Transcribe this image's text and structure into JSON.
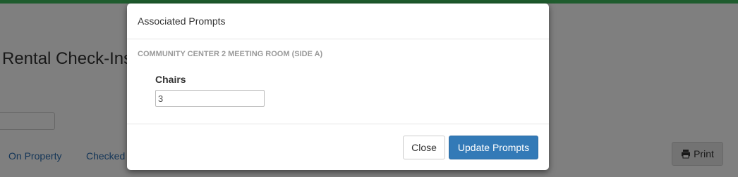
{
  "background_page": {
    "title": "Rental Check-Ins",
    "tabs": [
      {
        "label": "On Property"
      },
      {
        "label": "Checked Out"
      }
    ],
    "print_label": "Print",
    "print_icon": "print-icon",
    "accent_color": "#1f5c2e"
  },
  "modal": {
    "title": "Associated Prompts",
    "facility_name": "COMMUNITY CENTER 2 MEETING ROOM (SIDE A)",
    "prompts": [
      {
        "label": "Chairs",
        "value": "3"
      }
    ],
    "buttons": {
      "close_label": "Close",
      "update_label": "Update Prompts"
    },
    "primary_color": "#337ab7"
  }
}
